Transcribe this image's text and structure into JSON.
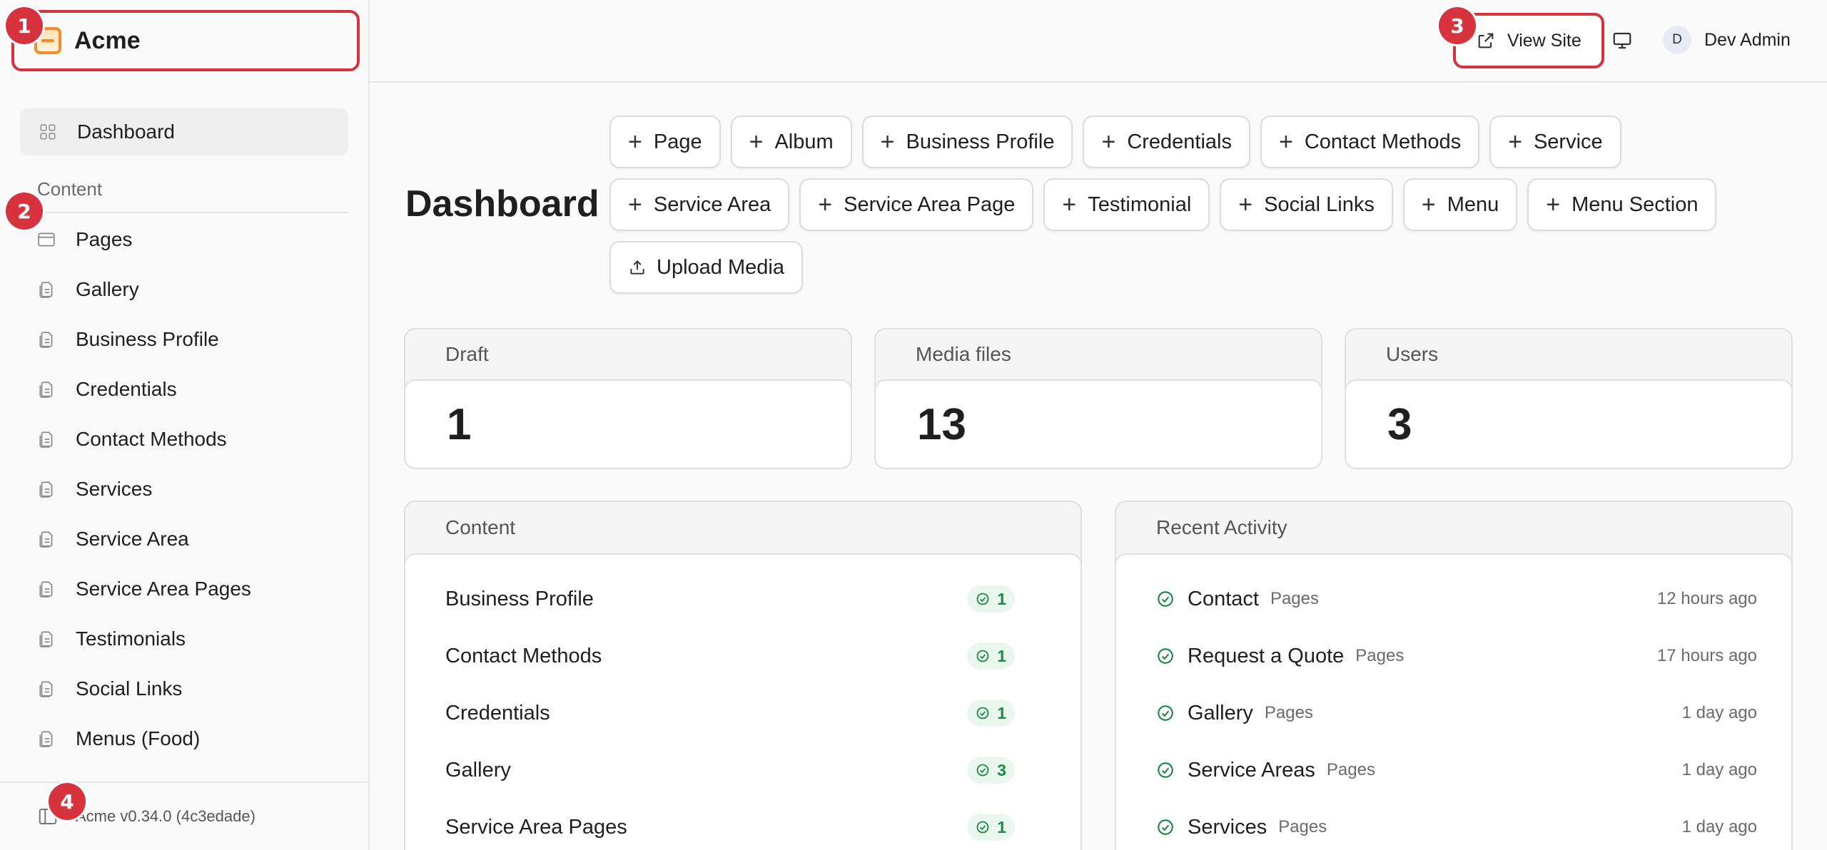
{
  "sidebar": {
    "brand": "Acme",
    "dashboard_label": "Dashboard",
    "section_label": "Content",
    "items": [
      {
        "label": "Pages",
        "icon": "page-icon"
      },
      {
        "label": "Gallery",
        "icon": "document-icon"
      },
      {
        "label": "Business Profile",
        "icon": "document-icon"
      },
      {
        "label": "Credentials",
        "icon": "document-icon"
      },
      {
        "label": "Contact Methods",
        "icon": "document-icon"
      },
      {
        "label": "Services",
        "icon": "document-icon"
      },
      {
        "label": "Service Area",
        "icon": "document-icon"
      },
      {
        "label": "Service Area Pages",
        "icon": "document-icon"
      },
      {
        "label": "Testimonials",
        "icon": "document-icon"
      },
      {
        "label": "Social Links",
        "icon": "document-icon"
      },
      {
        "label": "Menus (Food)",
        "icon": "document-icon"
      }
    ],
    "footer": "Acme v0.34.0 (4c3edade)"
  },
  "header": {
    "view_site": "View Site",
    "user_initial": "D",
    "user_name": "Dev Admin"
  },
  "annotations": [
    "1",
    "2",
    "3",
    "4"
  ],
  "main": {
    "title": "Dashboard",
    "quick_actions": [
      "Page",
      "Album",
      "Business Profile",
      "Credentials",
      "Contact Methods",
      "Service",
      "Service Area",
      "Service Area Page",
      "Testimonial",
      "Social Links",
      "Menu",
      "Menu Section"
    ],
    "upload_label": "Upload Media",
    "stats": [
      {
        "label": "Draft",
        "value": "1"
      },
      {
        "label": "Media files",
        "value": "13"
      },
      {
        "label": "Users",
        "value": "3"
      }
    ],
    "content_panel": {
      "title": "Content",
      "rows": [
        {
          "label": "Business Profile",
          "count": "1"
        },
        {
          "label": "Contact Methods",
          "count": "1"
        },
        {
          "label": "Credentials",
          "count": "1"
        },
        {
          "label": "Gallery",
          "count": "3"
        },
        {
          "label": "Service Area Pages",
          "count": "1"
        }
      ]
    },
    "activity_panel": {
      "title": "Recent Activity",
      "rows": [
        {
          "title": "Contact",
          "type": "Pages",
          "time": "12 hours ago"
        },
        {
          "title": "Request a Quote",
          "type": "Pages",
          "time": "17 hours ago"
        },
        {
          "title": "Gallery",
          "type": "Pages",
          "time": "1 day ago"
        },
        {
          "title": "Service Areas",
          "type": "Pages",
          "time": "1 day ago"
        },
        {
          "title": "Services",
          "type": "Pages",
          "time": "1 day ago"
        }
      ]
    }
  },
  "colors": {
    "annotation": "#d6333f",
    "brand_accent": "#f28c28",
    "success": "#1f8a44"
  }
}
